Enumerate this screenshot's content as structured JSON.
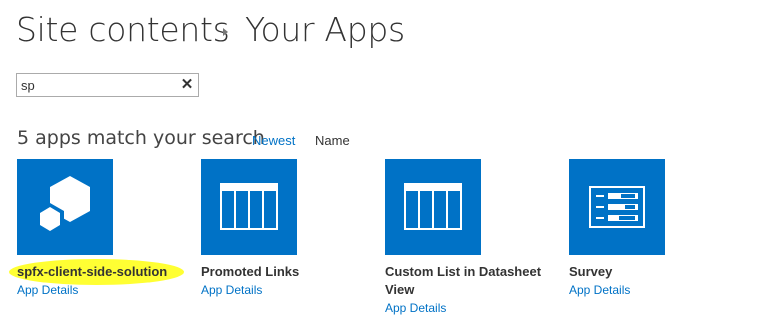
{
  "breadcrumb": {
    "parent": "Site contents",
    "current": "Your Apps"
  },
  "search": {
    "value": "sp",
    "clear_icon": "close-icon"
  },
  "results": {
    "heading": "5 apps match your search",
    "sort_newest": "Newest",
    "sort_name": "Name"
  },
  "apps": [
    {
      "title": "spfx-client-side-solution",
      "details": "App Details",
      "icon": "hexagon-cubes-icon",
      "highlighted": true
    },
    {
      "title": "Promoted Links",
      "details": "App Details",
      "icon": "promoted-links-icon",
      "highlighted": false
    },
    {
      "title": "Custom List in Datasheet View",
      "details": "App Details",
      "icon": "datasheet-list-icon",
      "highlighted": false
    },
    {
      "title": "Survey",
      "details": "App Details",
      "icon": "survey-icon",
      "highlighted": false
    }
  ],
  "colors": {
    "tile_blue": "#0072c6",
    "link_blue": "#0072c6",
    "highlight_yellow": "#ffff33"
  }
}
